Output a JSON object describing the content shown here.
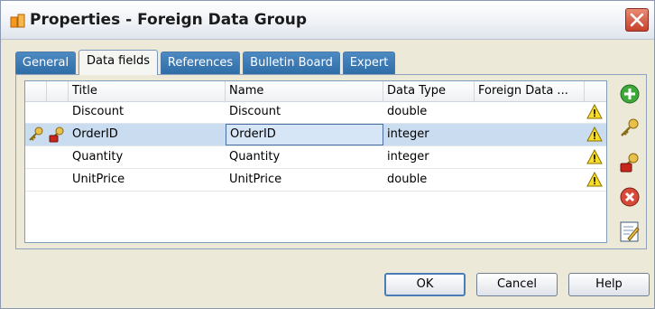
{
  "window": {
    "title": "Properties - Foreign Data Group"
  },
  "tabs": [
    {
      "label": "General",
      "active": false
    },
    {
      "label": "Data fields",
      "active": true
    },
    {
      "label": "References",
      "active": false
    },
    {
      "label": "Bulletin Board",
      "active": false
    },
    {
      "label": "Expert",
      "active": false
    }
  ],
  "grid": {
    "columns": [
      "Title",
      "Name",
      "Data Type",
      "Foreign Data ..."
    ],
    "rows": [
      {
        "title": "Discount",
        "name": "Discount",
        "type": "double",
        "foreign": "",
        "key": false
      },
      {
        "title": "OrderID",
        "name": "OrderID",
        "type": "integer",
        "foreign": "",
        "key": true
      },
      {
        "title": "Quantity",
        "name": "Quantity",
        "type": "integer",
        "foreign": "",
        "key": false
      },
      {
        "title": "UnitPrice",
        "name": "UnitPrice",
        "type": "double",
        "foreign": "",
        "key": false
      }
    ],
    "selected_row": 1
  },
  "side_buttons": [
    "add-icon",
    "key-icon",
    "lock-key-icon",
    "delete-icon",
    "edit-icon"
  ],
  "buttons": {
    "ok": "OK",
    "cancel": "Cancel",
    "help": "Help"
  },
  "colors": {
    "tab_blue": "#2f6da8",
    "selection": "#c9dcf0",
    "close_red": "#c6412b"
  }
}
